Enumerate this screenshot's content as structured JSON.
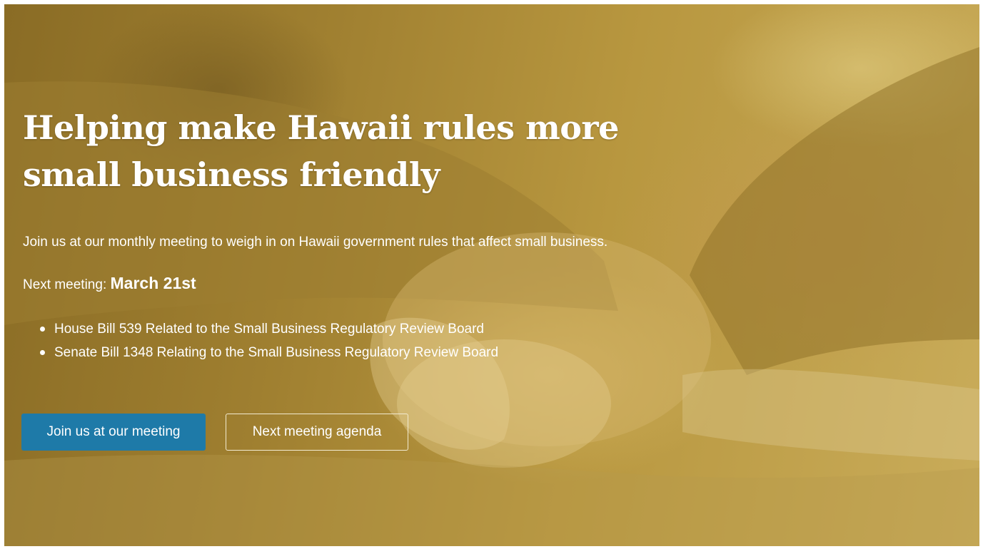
{
  "hero": {
    "title_line1": "Helping make Hawaii rules more",
    "title_line2": "small business friendly",
    "intro": "Join us at our monthly meeting to weigh in on Hawaii government rules that affect small business.",
    "next_meeting_label": "Next meeting:",
    "next_meeting_date": "March 21st",
    "bills": [
      {
        "text": "House Bill 539 Related to the Small Business Regulatory Review Board"
      },
      {
        "text": "Senate Bill 1348 Relating to the Small Business Regulatory Review Board"
      }
    ],
    "buttons": {
      "join_label": "Join us at our meeting",
      "agenda_label": "Next meeting agenda"
    }
  },
  "colors": {
    "overlay_gold": "#a8893a",
    "primary_button": "#1e7aa8",
    "text": "#ffffff"
  }
}
